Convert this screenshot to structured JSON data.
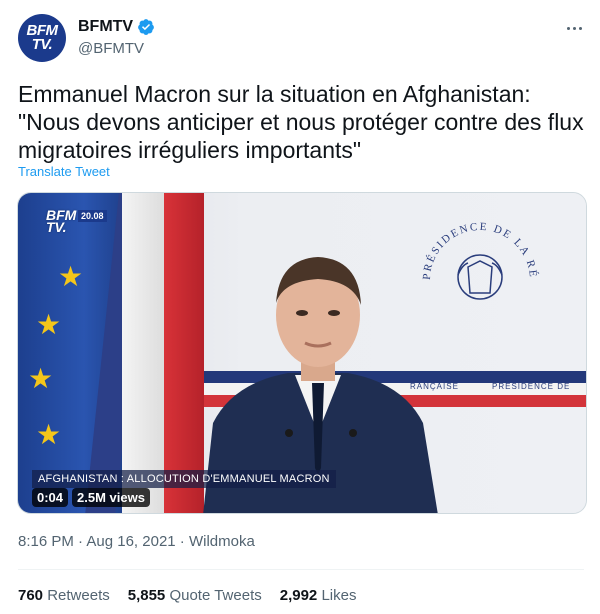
{
  "account": {
    "avatar_line1": "BFM",
    "avatar_line2": "TV.",
    "display_name": "BFMTV",
    "handle": "@BFMTV"
  },
  "tweet": {
    "text": "Emmanuel Macron sur la situation en Afghanistan:\n\"Nous devons anticiper et nous protéger contre des flux migratoires irréguliers importants\"",
    "translate_label": "Translate Tweet"
  },
  "media": {
    "channel_logo_line1": "BFM",
    "channel_logo_line2": "TV.",
    "time_badge": "20.08",
    "seal_text": "PRÉSIDENCE DE LA RÉPUBLIQUE",
    "band_text_left": "RANÇAISE",
    "band_text_right": "PRÉSIDENCE DE",
    "caption": "AFGHANISTAN : ALLOCUTION D'EMMANUEL MACRON",
    "duration": "0:04",
    "views": "2.5M views"
  },
  "meta": {
    "time": "8:16 PM",
    "separator1": " · ",
    "date": "Aug 16, 2021",
    "separator2": " · ",
    "source": "Wildmoka"
  },
  "stats": {
    "retweets_count": "760",
    "retweets_label": "Retweets",
    "quotes_count": "5,855",
    "quotes_label": "Quote Tweets",
    "likes_count": "2,992",
    "likes_label": "Likes"
  },
  "colors": {
    "accent": "#1d9bf0",
    "avatar_bg": "#1b3a8c"
  }
}
